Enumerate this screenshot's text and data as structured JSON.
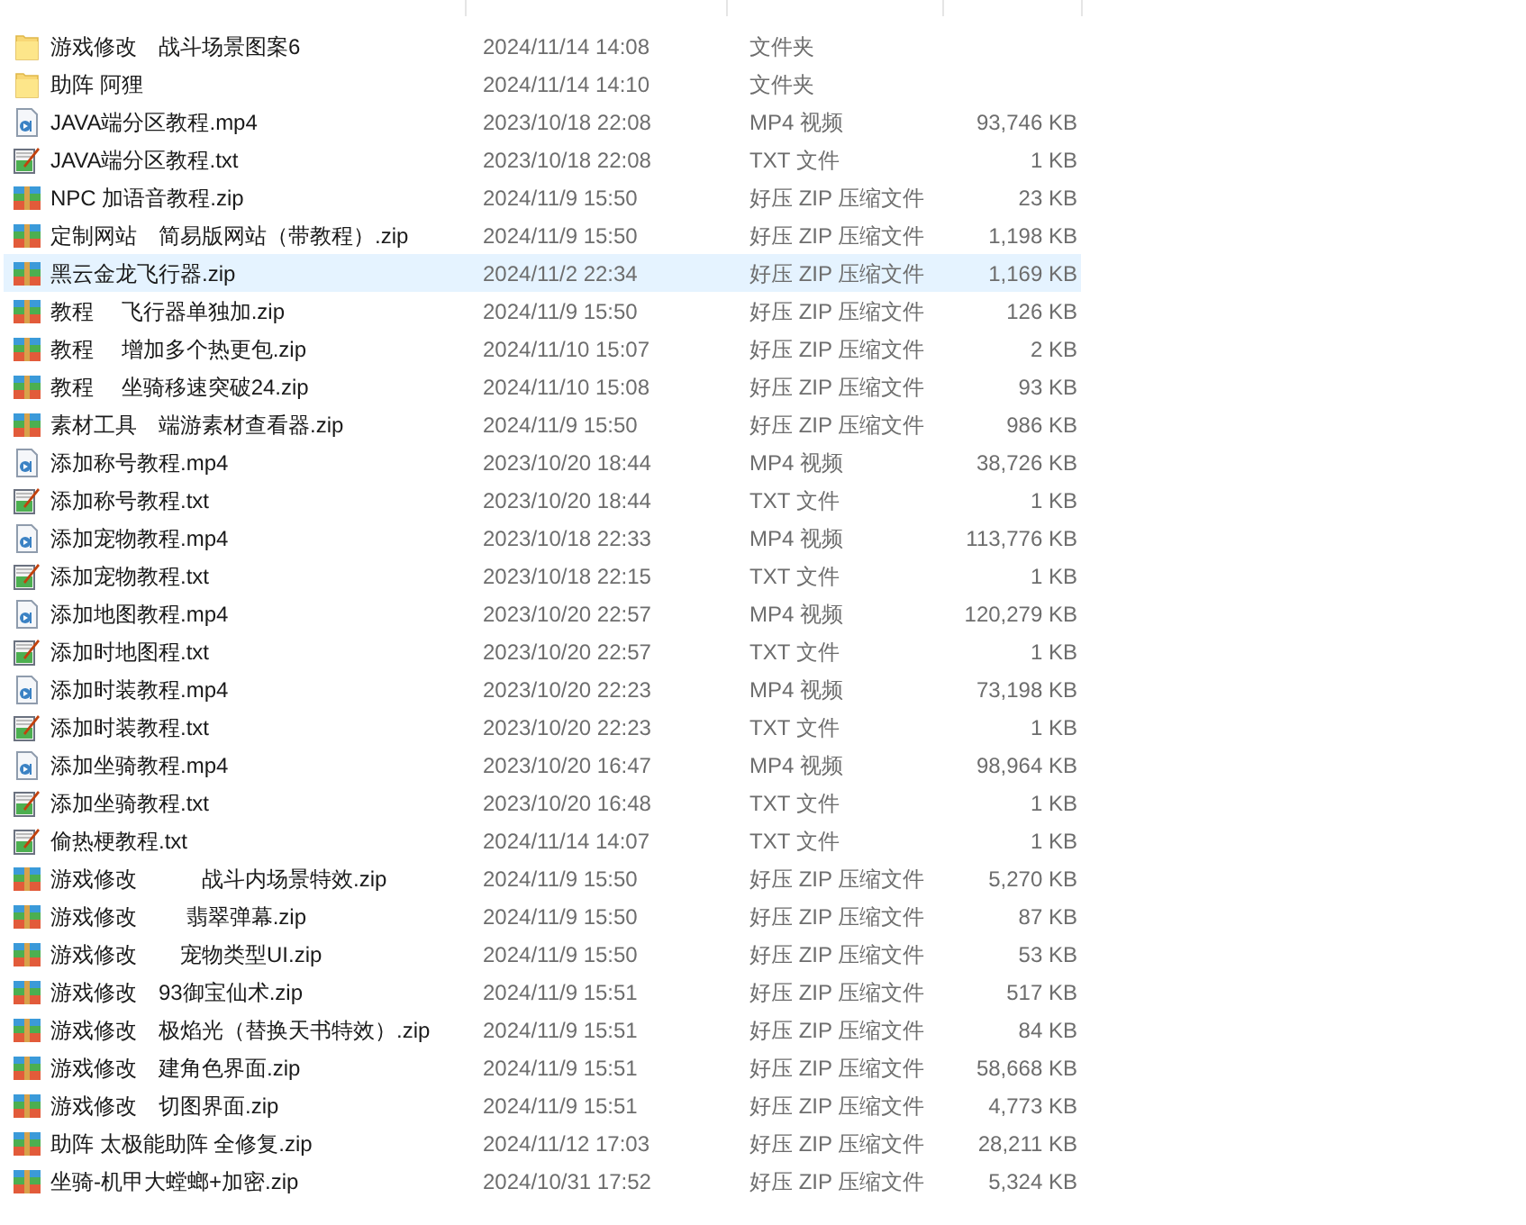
{
  "files": [
    {
      "kind": "folder",
      "name": "游戏修改　战斗场景图案6",
      "modified": "2024/11/14 14:08",
      "type": "文件夹",
      "selected": false
    },
    {
      "kind": "folder",
      "name": "助阵 阿狸",
      "modified": "2024/11/14 14:10",
      "type": "文件夹",
      "selected": false
    },
    {
      "kind": "video",
      "name": "JAVA端分区教程.mp4",
      "modified": "2023/10/18 22:08",
      "type": "MP4 视频",
      "size": "93,746 KB",
      "selected": false
    },
    {
      "kind": "text",
      "name": "JAVA端分区教程.txt",
      "modified": "2023/10/18 22:08",
      "type": "TXT 文件",
      "size": "1 KB",
      "selected": false
    },
    {
      "kind": "zip",
      "name": "NPC 加语音教程.zip",
      "modified": "2024/11/9 15:50",
      "type": "好压 ZIP 压缩文件",
      "size": "23 KB",
      "selected": false
    },
    {
      "kind": "zip",
      "name": "定制网站　简易版网站（带教程）.zip",
      "modified": "2024/11/9 15:50",
      "type": "好压 ZIP 压缩文件",
      "size": "1,198 KB",
      "selected": false
    },
    {
      "kind": "zip",
      "name": "黑云金龙飞行器.zip",
      "modified": "2024/11/2 22:34",
      "type": "好压 ZIP 压缩文件",
      "size": "1,169 KB",
      "selected": true
    },
    {
      "kind": "zip",
      "name": "教程　 飞行器单独加.zip",
      "modified": "2024/11/9 15:50",
      "type": "好压 ZIP 压缩文件",
      "size": "126 KB",
      "selected": false
    },
    {
      "kind": "zip",
      "name": "教程　 增加多个热更包.zip",
      "modified": "2024/11/10 15:07",
      "type": "好压 ZIP 压缩文件",
      "size": "2 KB",
      "selected": false
    },
    {
      "kind": "zip",
      "name": "教程　 坐骑移速突破24.zip",
      "modified": "2024/11/10 15:08",
      "type": "好压 ZIP 压缩文件",
      "size": "93 KB",
      "selected": false
    },
    {
      "kind": "zip",
      "name": "素材工具　端游素材查看器.zip",
      "modified": "2024/11/9 15:50",
      "type": "好压 ZIP 压缩文件",
      "size": "986 KB",
      "selected": false
    },
    {
      "kind": "video",
      "name": "添加称号教程.mp4",
      "modified": "2023/10/20 18:44",
      "type": "MP4 视频",
      "size": "38,726 KB",
      "selected": false
    },
    {
      "kind": "text",
      "name": "添加称号教程.txt",
      "modified": "2023/10/20 18:44",
      "type": "TXT 文件",
      "size": "1 KB",
      "selected": false
    },
    {
      "kind": "video",
      "name": "添加宠物教程.mp4",
      "modified": "2023/10/18 22:33",
      "type": "MP4 视频",
      "size": "113,776 KB",
      "selected": false
    },
    {
      "kind": "text",
      "name": "添加宠物教程.txt",
      "modified": "2023/10/18 22:15",
      "type": "TXT 文件",
      "size": "1 KB",
      "selected": false
    },
    {
      "kind": "video",
      "name": "添加地图教程.mp4",
      "modified": "2023/10/20 22:57",
      "type": "MP4 视频",
      "size": "120,279 KB",
      "selected": false
    },
    {
      "kind": "text",
      "name": "添加时地图程.txt",
      "modified": "2023/10/20 22:57",
      "type": "TXT 文件",
      "size": "1 KB",
      "selected": false
    },
    {
      "kind": "video",
      "name": "添加时装教程.mp4",
      "modified": "2023/10/20 22:23",
      "type": "MP4 视频",
      "size": "73,198 KB",
      "selected": false
    },
    {
      "kind": "text",
      "name": "添加时装教程.txt",
      "modified": "2023/10/20 22:23",
      "type": "TXT 文件",
      "size": "1 KB",
      "selected": false
    },
    {
      "kind": "video",
      "name": "添加坐骑教程.mp4",
      "modified": "2023/10/20 16:47",
      "type": "MP4 视频",
      "size": "98,964 KB",
      "selected": false
    },
    {
      "kind": "text",
      "name": "添加坐骑教程.txt",
      "modified": "2023/10/20 16:48",
      "type": "TXT 文件",
      "size": "1 KB",
      "selected": false
    },
    {
      "kind": "text",
      "name": "偷热梗教程.txt",
      "modified": "2024/11/14 14:07",
      "type": "TXT 文件",
      "size": "1 KB",
      "selected": false
    },
    {
      "kind": "zip",
      "name": "游戏修改　　　战斗内场景特效.zip",
      "modified": "2024/11/9 15:50",
      "type": "好压 ZIP 压缩文件",
      "size": "5,270 KB",
      "selected": false
    },
    {
      "kind": "zip",
      "name": "游戏修改　　 翡翠弹幕.zip",
      "modified": "2024/11/9 15:50",
      "type": "好压 ZIP 压缩文件",
      "size": "87 KB",
      "selected": false
    },
    {
      "kind": "zip",
      "name": "游戏修改　　宠物类型UI.zip",
      "modified": "2024/11/9 15:50",
      "type": "好压 ZIP 压缩文件",
      "size": "53 KB",
      "selected": false
    },
    {
      "kind": "zip",
      "name": "游戏修改　93御宝仙术.zip",
      "modified": "2024/11/9 15:51",
      "type": "好压 ZIP 压缩文件",
      "size": "517 KB",
      "selected": false
    },
    {
      "kind": "zip",
      "name": "游戏修改　极焰光（替换天书特效）.zip",
      "modified": "2024/11/9 15:51",
      "type": "好压 ZIP 压缩文件",
      "size": "84 KB",
      "selected": false
    },
    {
      "kind": "zip",
      "name": "游戏修改　建角色界面.zip",
      "modified": "2024/11/9 15:51",
      "type": "好压 ZIP 压缩文件",
      "size": "58,668 KB",
      "selected": false
    },
    {
      "kind": "zip",
      "name": "游戏修改　切图界面.zip",
      "modified": "2024/11/9 15:51",
      "type": "好压 ZIP 压缩文件",
      "size": "4,773 KB",
      "selected": false
    },
    {
      "kind": "zip",
      "name": "助阵 太极能助阵 全修复.zip",
      "modified": "2024/11/12 17:03",
      "type": "好压 ZIP 压缩文件",
      "size": "28,211 KB",
      "selected": false
    },
    {
      "kind": "zip",
      "name": "坐骑-机甲大螳螂+加密.zip",
      "modified": "2024/10/31 17:52",
      "type": "好压 ZIP 压缩文件",
      "size": "5,324 KB",
      "selected": false
    }
  ]
}
